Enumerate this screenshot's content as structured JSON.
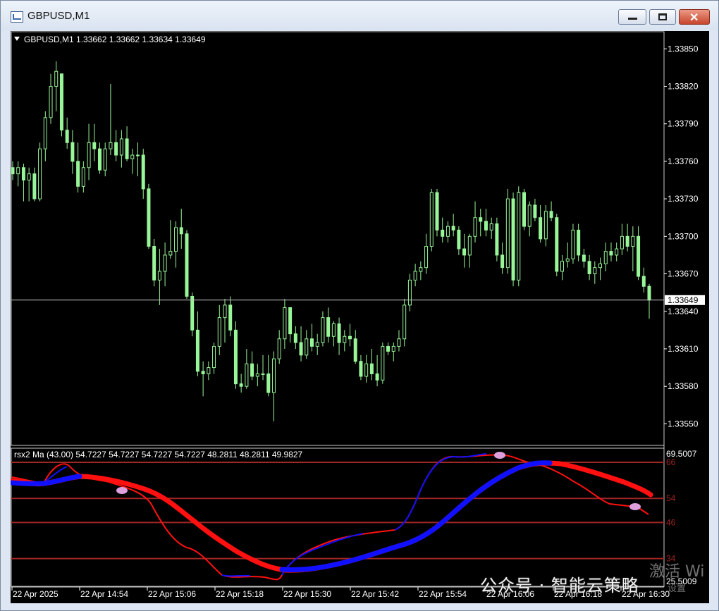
{
  "window": {
    "title": "GBPUSD,M1"
  },
  "main_chart": {
    "header": "GBPUSD,M1  1.33662 1.33662 1.33634 1.33649",
    "current_price": "1.33649",
    "current_price_value": 1.33649,
    "price_labels": [
      "1.33850",
      "1.33820",
      "1.33790",
      "1.33760",
      "1.33730",
      "1.33700",
      "1.33670",
      "1.33640",
      "1.33610",
      "1.33580",
      "1.33550"
    ],
    "colors": {
      "background": "#000000",
      "candle": "#98f598",
      "price_line": "#c0c0c0",
      "axis": "#ffffff"
    }
  },
  "indicator": {
    "header": "rsx2 Ma (43.00) 54.7227 54.7227 54.7227 54.7227 48.2811 48.2811 49.9827",
    "max_label": "69.5007",
    "min_label": "25.5009",
    "levels": [
      {
        "label": "66",
        "value": 66
      },
      {
        "label": "54",
        "value": 54
      },
      {
        "label": "46",
        "value": 46
      },
      {
        "label": "34",
        "value": 34
      }
    ],
    "colors": {
      "level_line": "#a02525",
      "up": "#1010ff",
      "down": "#ff1010",
      "marker": "#dda0dd"
    }
  },
  "time_labels": [
    "22 Apr 2025",
    "22 Apr 14:54",
    "22 Apr 15:06",
    "22 Apr 15:18",
    "22 Apr 15:30",
    "22 Apr 15:42",
    "22 Apr 15:54",
    "22 Apr 16:06",
    "22 Apr 16:18",
    "22 Apr 16:30"
  ],
  "watermark": {
    "text": "公众号 · 智能云策略",
    "overlay": "激活 Wi",
    "overlay2": "设置"
  },
  "chart_data": {
    "type": "candlestick",
    "symbol": "GBPUSD",
    "timeframe": "M1",
    "ylim": [
      1.33535,
      1.33862
    ],
    "candles": [
      [
        1.33755,
        1.3376,
        1.33745,
        1.3375
      ],
      [
        1.3375,
        1.3376,
        1.3374,
        1.33755
      ],
      [
        1.33755,
        1.33758,
        1.33728,
        1.33745
      ],
      [
        1.33745,
        1.33755,
        1.33728,
        1.3375
      ],
      [
        1.3375,
        1.33755,
        1.33728,
        1.3373
      ],
      [
        1.3373,
        1.33775,
        1.33728,
        1.3377
      ],
      [
        1.3377,
        1.338,
        1.3376,
        1.33795
      ],
      [
        1.33795,
        1.3383,
        1.3379,
        1.3382
      ],
      [
        1.3382,
        1.3384,
        1.338,
        1.33832
      ],
      [
        1.3383,
        1.3383,
        1.3378,
        1.33785
      ],
      [
        1.33785,
        1.33795,
        1.3377,
        1.33775
      ],
      [
        1.33775,
        1.33785,
        1.3375,
        1.3376
      ],
      [
        1.3376,
        1.33775,
        1.33735,
        1.3374
      ],
      [
        1.3374,
        1.3376,
        1.33735,
        1.33755
      ],
      [
        1.33755,
        1.3379,
        1.33745,
        1.33775
      ],
      [
        1.33775,
        1.3379,
        1.3376,
        1.3377
      ],
      [
        1.3377,
        1.33775,
        1.3375,
        1.33753
      ],
      [
        1.33753,
        1.33775,
        1.33748,
        1.3377
      ],
      [
        1.3377,
        1.33822,
        1.33765,
        1.33775
      ],
      [
        1.33775,
        1.33785,
        1.3376,
        1.33765
      ],
      [
        1.33765,
        1.33785,
        1.33755,
        1.33778
      ],
      [
        1.33778,
        1.33788,
        1.3376,
        1.33762
      ],
      [
        1.33762,
        1.3377,
        1.3375,
        1.33765
      ],
      [
        1.33765,
        1.33775,
        1.33748,
        1.33765
      ],
      [
        1.33765,
        1.3377,
        1.3373,
        1.33738
      ],
      [
        1.33738,
        1.33742,
        1.3369,
        1.33692
      ],
      [
        1.33692,
        1.33698,
        1.3366,
        1.33665
      ],
      [
        1.33665,
        1.3369,
        1.33645,
        1.33672
      ],
      [
        1.33672,
        1.33695,
        1.3366,
        1.33685
      ],
      [
        1.33685,
        1.33713,
        1.33682,
        1.33688
      ],
      [
        1.33688,
        1.33712,
        1.33675,
        1.33707
      ],
      [
        1.33707,
        1.33722,
        1.3369,
        1.33702
      ],
      [
        1.33702,
        1.33705,
        1.3365,
        1.33652
      ],
      [
        1.33652,
        1.33655,
        1.3362,
        1.33625
      ],
      [
        1.33625,
        1.3364,
        1.33588,
        1.33592
      ],
      [
        1.33592,
        1.336,
        1.33572,
        1.3359
      ],
      [
        1.3359,
        1.336,
        1.33585,
        1.33595
      ],
      [
        1.33595,
        1.33615,
        1.3359,
        1.33612
      ],
      [
        1.33612,
        1.33645,
        1.33605,
        1.33635
      ],
      [
        1.33635,
        1.3365,
        1.33615,
        1.33645
      ],
      [
        1.33645,
        1.33652,
        1.3362,
        1.33625
      ],
      [
        1.33625,
        1.33632,
        1.33578,
        1.33582
      ],
      [
        1.33582,
        1.3359,
        1.33575,
        1.3358
      ],
      [
        1.3358,
        1.3361,
        1.33578,
        1.33598
      ],
      [
        1.33598,
        1.33608,
        1.33585,
        1.33588
      ],
      [
        1.33588,
        1.33598,
        1.3358,
        1.3359
      ],
      [
        1.3359,
        1.33605,
        1.33585,
        1.3359
      ],
      [
        1.3359,
        1.33605,
        1.33572,
        1.33575
      ],
      [
        1.33575,
        1.33608,
        1.33552,
        1.33602
      ],
      [
        1.33602,
        1.33625,
        1.33598,
        1.33618
      ],
      [
        1.33618,
        1.3365,
        1.3361,
        1.33643
      ],
      [
        1.33643,
        1.33643,
        1.33615,
        1.33622
      ],
      [
        1.33622,
        1.33628,
        1.3361,
        1.33615
      ],
      [
        1.33615,
        1.33628,
        1.336,
        1.33605
      ],
      [
        1.33605,
        1.33625,
        1.33602,
        1.33618
      ],
      [
        1.33618,
        1.3363,
        1.33608,
        1.33612
      ],
      [
        1.33612,
        1.33622,
        1.33605,
        1.33615
      ],
      [
        1.33615,
        1.3364,
        1.33612,
        1.33635
      ],
      [
        1.33635,
        1.33643,
        1.33615,
        1.3362
      ],
      [
        1.3362,
        1.33632,
        1.33612,
        1.3363
      ],
      [
        1.3363,
        1.33635,
        1.33605,
        1.33615
      ],
      [
        1.33615,
        1.33625,
        1.33608,
        1.3362
      ],
      [
        1.3362,
        1.3363,
        1.33612,
        1.33618
      ],
      [
        1.33618,
        1.33625,
        1.33598,
        1.336
      ],
      [
        1.336,
        1.33605,
        1.33585,
        1.33588
      ],
      [
        1.33588,
        1.33605,
        1.33583,
        1.33598
      ],
      [
        1.33598,
        1.3361,
        1.33585,
        1.3359
      ],
      [
        1.3359,
        1.33605,
        1.3358,
        1.33585
      ],
      [
        1.33585,
        1.33615,
        1.33582,
        1.33612
      ],
      [
        1.33612,
        1.33615,
        1.33605,
        1.33608
      ],
      [
        1.33608,
        1.33615,
        1.336,
        1.33612
      ],
      [
        1.33612,
        1.33625,
        1.33608,
        1.33618
      ],
      [
        1.33618,
        1.3365,
        1.33612,
        1.33645
      ],
      [
        1.33645,
        1.3367,
        1.3364,
        1.33665
      ],
      [
        1.33665,
        1.33678,
        1.3366,
        1.33672
      ],
      [
        1.33672,
        1.3368,
        1.33665,
        1.33675
      ],
      [
        1.33675,
        1.33702,
        1.3367,
        1.33692
      ],
      [
        1.33692,
        1.33738,
        1.33688,
        1.33735
      ],
      [
        1.33735,
        1.33738,
        1.337,
        1.33705
      ],
      [
        1.33705,
        1.33715,
        1.33695,
        1.337
      ],
      [
        1.337,
        1.33712,
        1.33695,
        1.33708
      ],
      [
        1.33708,
        1.33718,
        1.337,
        1.33705
      ],
      [
        1.33705,
        1.33708,
        1.33685,
        1.3369
      ],
      [
        1.3369,
        1.33702,
        1.33675,
        1.33685
      ],
      [
        1.33685,
        1.33702,
        1.33675,
        1.337
      ],
      [
        1.337,
        1.33728,
        1.33695,
        1.33715
      ],
      [
        1.33715,
        1.33722,
        1.337,
        1.33712
      ],
      [
        1.33712,
        1.33722,
        1.337,
        1.33705
      ],
      [
        1.33705,
        1.33715,
        1.33698,
        1.3371
      ],
      [
        1.3371,
        1.33715,
        1.3368,
        1.33685
      ],
      [
        1.33685,
        1.33695,
        1.3367,
        1.33675
      ],
      [
        1.33675,
        1.33738,
        1.3367,
        1.3373
      ],
      [
        1.3373,
        1.33735,
        1.3366,
        1.33665
      ],
      [
        1.33665,
        1.3374,
        1.3366,
        1.33735
      ],
      [
        1.33735,
        1.33738,
        1.33705,
        1.33708
      ],
      [
        1.33708,
        1.33728,
        1.337,
        1.33725
      ],
      [
        1.33725,
        1.3373,
        1.33712,
        1.33715
      ],
      [
        1.33715,
        1.33725,
        1.33695,
        1.33698
      ],
      [
        1.33698,
        1.33725,
        1.33692,
        1.3372
      ],
      [
        1.3372,
        1.33728,
        1.33712,
        1.33715
      ],
      [
        1.33715,
        1.33718,
        1.33668,
        1.33672
      ],
      [
        1.33672,
        1.33685,
        1.33665,
        1.3368
      ],
      [
        1.3368,
        1.33695,
        1.33675,
        1.33682
      ],
      [
        1.33682,
        1.3371,
        1.33678,
        1.33705
      ],
      [
        1.33705,
        1.3371,
        1.3368,
        1.33685
      ],
      [
        1.33685,
        1.3369,
        1.33675,
        1.3368
      ],
      [
        1.3368,
        1.33685,
        1.33665,
        1.3367
      ],
      [
        1.3367,
        1.3368,
        1.33662,
        1.33675
      ],
      [
        1.33675,
        1.33683,
        1.33665,
        1.33678
      ],
      [
        1.33678,
        1.33695,
        1.33672,
        1.33688
      ],
      [
        1.33688,
        1.33695,
        1.3368,
        1.33685
      ],
      [
        1.33685,
        1.33695,
        1.3368,
        1.3369
      ],
      [
        1.3369,
        1.3371,
        1.33685,
        1.337
      ],
      [
        1.337,
        1.3371,
        1.33688,
        1.33692
      ],
      [
        1.33692,
        1.33708,
        1.33672,
        1.337
      ],
      [
        1.337,
        1.33708,
        1.33665,
        1.33668
      ],
      [
        1.33668,
        1.33675,
        1.33655,
        1.3366
      ],
      [
        1.3366,
        1.33662,
        1.33634,
        1.33649
      ]
    ]
  }
}
